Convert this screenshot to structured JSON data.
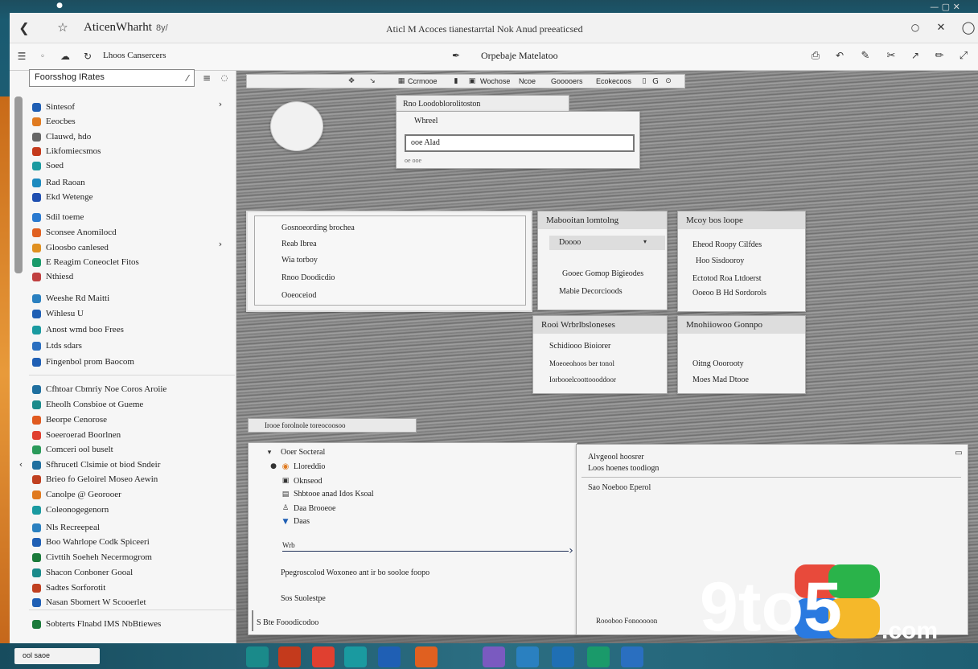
{
  "window": {
    "title": "AticenWharht",
    "title_suffix": "8y/",
    "center_title": "Aticl M Acoces tianestarrtal Nok Anud preeaticsed"
  },
  "cmdbar": {
    "crumb": "Lhoos Cansercers",
    "center": "Orpebaje Matelatoo"
  },
  "sidebar": {
    "search_value": "Foorsshog IRates",
    "items": [
      {
        "label": "Sintesof",
        "color": "#1f5fb4"
      },
      {
        "label": "Eeocbes",
        "color": "#e07a1f"
      },
      {
        "label": "Clauwd, hdo",
        "color": "#666"
      },
      {
        "label": "Likfomiecsmos",
        "color": "#c43a1c"
      },
      {
        "label": "Soed",
        "color": "#1a9aa0"
      },
      {
        "label": "Rad Raoan",
        "color": "#1c8abf"
      },
      {
        "label": "Ekd Wetenge",
        "color": "#1f4fb0"
      },
      {
        "label": "Sdil toeme",
        "color": "#2a7ad0"
      },
      {
        "label": "Sconsee Anomilocd",
        "color": "#e06020"
      },
      {
        "label": "Gloosbo canlesed",
        "color": "#e09020"
      },
      {
        "label": "E Reagim Coneoclet Fitos",
        "color": "#1a9a6a"
      },
      {
        "label": "Nthiesd",
        "color": "#c04040"
      },
      {
        "label": "Weeshe Rd Maitti",
        "color": "#2a80c0"
      },
      {
        "label": "Wihlesu U",
        "color": "#1f5fb4"
      },
      {
        "label": "Anost wmd boo Frees",
        "color": "#1a9aa0"
      },
      {
        "label": "Ltds sdars",
        "color": "#2a6fc0"
      },
      {
        "label": "Fingenbol prom Baocom",
        "color": "#1f5fb4"
      },
      {
        "label": "Cfhtoar Cbmriy Noe Coros Aroiie",
        "color": "#1f6f9f"
      },
      {
        "label": "Eheolh Consbioe ot Gueme",
        "color": "#1a8a8a"
      },
      {
        "label": "Beorpe Cenorose",
        "color": "#e05a1f"
      },
      {
        "label": "Soeeroerad Boorlnen",
        "color": "#e04030"
      },
      {
        "label": "Comceri ool buselt",
        "color": "#2a9a5a"
      },
      {
        "label": "Sfhrucetl Clsimie ot biod Sndeir",
        "color": "#1f6f9f"
      },
      {
        "label": "Brieo fo Geloirel Moseo Aewin",
        "color": "#c04020"
      },
      {
        "label": "Canolpe @ Georooer",
        "color": "#e07a1f"
      },
      {
        "label": "Coleonogegenorn",
        "color": "#1a9aa0"
      },
      {
        "label": "Nls Recreepeal",
        "color": "#2a80c0"
      },
      {
        "label": "Boo Wahrlope Codk Spiceeri",
        "color": "#1f5fb4"
      },
      {
        "label": "Civttih Soeheh Necermogrom",
        "color": "#1a7a3a"
      },
      {
        "label": "Shacon Conboner Gooal",
        "color": "#1a8a8a"
      },
      {
        "label": "Sadtes Sorforotit",
        "color": "#c04020"
      },
      {
        "label": "Nasan Sbomert W Scooerlet",
        "color": "#1f5fb4"
      },
      {
        "label": "Sobterts Flnabd IMS NbBtiewes",
        "color": "#1a7a3a"
      }
    ]
  },
  "toolstrip": [
    "Ccrmooe",
    "Wochose",
    "Ncoe",
    "Gooooers",
    "Ecokecoos"
  ],
  "pop1": {
    "title": "Rno Loodoblorolitoston",
    "row1": "Whreel",
    "input": "ooe Alad",
    "hint": "oe ooe"
  },
  "p_list1": {
    "items": [
      "Gosnoeording brochea",
      "Reab Ibrea",
      "Wia torboy",
      "Rnoo Doodicdio",
      "Ooeoceiod"
    ]
  },
  "p_list2": {
    "title": "Mabooitan lomtolng",
    "sel": "Doooo",
    "items": [
      "Gooec Gomop Bigieodes",
      "Mabie Decorcioods"
    ]
  },
  "p_list3": {
    "title": "Mcoy bos loope",
    "items": [
      "Eheod Roopy Cilfdes",
      "Hoo Sisdooroy",
      "Ectotod Roa Ltdoerst",
      "Ooeoo B Hd Sordorols"
    ]
  },
  "p_list4": {
    "title": "Rooi Wrbrlbsloneses",
    "items": [
      "Schidiooo Bioiorer",
      "Moeoeohoos ber tonol",
      "Iorbooelcoottoooddoor"
    ]
  },
  "p_list5": {
    "title": "Mnohiiowoo Gonnpo",
    "items": [
      "Oitng Ooorooty",
      "Moes Mad Dtooe"
    ]
  },
  "lower_tab": "Irooe forolnole toreocoosoo",
  "tree": {
    "items": [
      "Ooer Socteral",
      "Lloreddio",
      "Oknseod",
      "Shbtooe anad Idos Ksoal",
      "Daa Brooeoe",
      "Daas"
    ],
    "arrow_label": "Wrb",
    "line1": "Ppegroscolod Woxoneo ant ir bo sooloe foopo",
    "line2": "Sos Suolestpe",
    "footer": "S Bte Fooodicodoo"
  },
  "detail": {
    "lines": [
      "Alvgeool hoosrer",
      "Loos hoenes toodiogn",
      "Sao Noeboo Eperol"
    ],
    "footer": "Roooboo Fonooooon"
  },
  "taskbar": {
    "start_text": "ool saoe"
  },
  "watermark": {
    "text1": "9to5",
    "text2": ".com"
  },
  "colors": {
    "accent": "#1f5fb4",
    "orange": "#e0892a",
    "taskbar": "#1f5f73"
  }
}
